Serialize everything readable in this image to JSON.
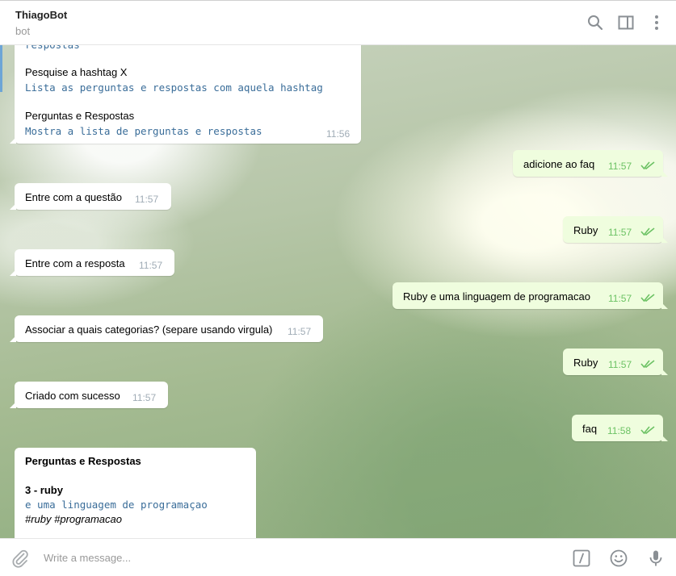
{
  "header": {
    "title": "ThiagoBot",
    "subtitle": "bot",
    "icons": [
      "search-icon",
      "side-panel-icon",
      "more-vertical-icon"
    ]
  },
  "messages": {
    "m0": {
      "cut_text": "respostas",
      "cmd1_title": "Pesquise a hashtag X",
      "cmd1_desc": "Lista as perguntas e respostas com aquela hashtag",
      "cmd2_title": "Perguntas e Respostas",
      "cmd2_desc": "Mostra a lista de perguntas e respostas",
      "time": "11:56"
    },
    "m1": {
      "text": "adicione ao faq",
      "time": "11:57"
    },
    "m2": {
      "text": "Entre com a questão",
      "time": "11:57"
    },
    "m3": {
      "text": "Ruby",
      "time": "11:57"
    },
    "m4": {
      "text": "Entre com a resposta",
      "time": "11:57"
    },
    "m5": {
      "text": "Ruby e uma linguagem de programacao",
      "time": "11:57"
    },
    "m6": {
      "text": "Associar a quais categorias? (separe usando virgula)",
      "time": "11:57"
    },
    "m7": {
      "text": "Ruby",
      "time": "11:57"
    },
    "m8": {
      "text": "Criado com sucesso",
      "time": "11:57"
    },
    "m9": {
      "text": "faq",
      "time": "11:58"
    },
    "m10": {
      "title": "Perguntas e Respostas",
      "item_title": "3 - ruby",
      "item_desc": "e uma linguagem de programaçao",
      "item_tags": "#ruby #programacao"
    }
  },
  "composer": {
    "placeholder": "Write a message...",
    "icons": [
      "attach-icon",
      "bot-command-icon",
      "emoji-icon",
      "microphone-icon"
    ]
  },
  "colors": {
    "outgoing_bubble": "#effdde",
    "incoming_bubble": "#ffffff",
    "read_check": "#6cc264",
    "command_text": "#3a6d99"
  }
}
